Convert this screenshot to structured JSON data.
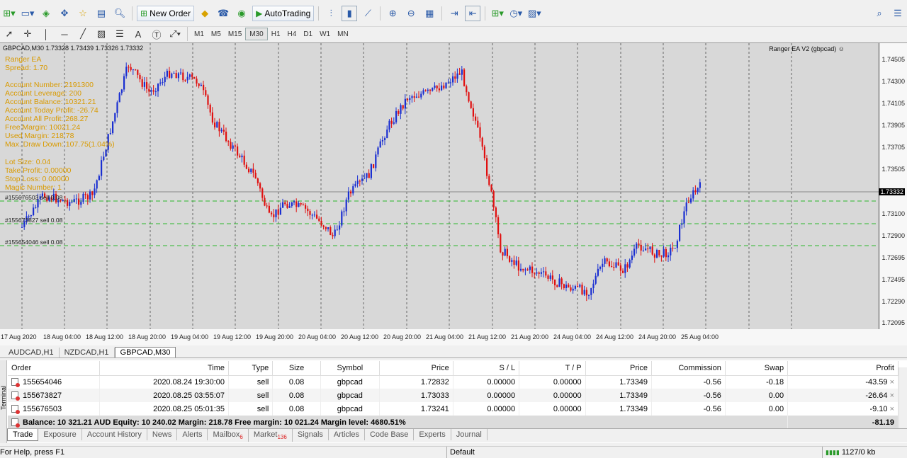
{
  "toolbar": {
    "new_order_label": "New Order",
    "autotrading_label": "AutoTrading",
    "timeframes": [
      "M1",
      "M5",
      "M15",
      "M30",
      "H1",
      "H4",
      "D1",
      "W1",
      "MN"
    ],
    "active_timeframe": "M30"
  },
  "chart": {
    "title": "GBPCAD,M30  1.73328 1.73439 1.73326 1.73332",
    "ea_label": "Ranger EA V2 (gbpcad) ☺",
    "current_price": "1.73332",
    "y_ticks": [
      "1.74505",
      "1.74300",
      "1.74105",
      "1.73905",
      "1.73705",
      "1.73505",
      "1.73100",
      "1.72900",
      "1.72695",
      "1.72495",
      "1.72290",
      "1.72095"
    ],
    "x_ticks": [
      "17 Aug 2020",
      "18 Aug 04:00",
      "18 Aug 12:00",
      "18 Aug 20:00",
      "19 Aug 04:00",
      "19 Aug 12:00",
      "19 Aug 20:00",
      "20 Aug 04:00",
      "20 Aug 12:00",
      "20 Aug 20:00",
      "21 Aug 04:00",
      "21 Aug 12:00",
      "21 Aug 20:00",
      "24 Aug 04:00",
      "24 Aug 12:00",
      "24 Aug 20:00",
      "25 Aug 04:00"
    ],
    "info_lines": [
      "Ranger EA",
      "Spread: 1.70",
      "Account Number: 2191300",
      "Account Leverage: 200",
      "Account Balance: 10321.21",
      "Account Today Profit: -26.74",
      "Account All Profit: 268.27",
      "Free Margin: 10021.24",
      "Used Margin: 218.78",
      "Max. Draw Down: 107.75(1.04%)",
      "Lot Size: 0.04",
      "Take Profit: 0.00000",
      "Stop Loss: 0.00000",
      "Magic Number: 1"
    ],
    "trade_labels": [
      "#155676503 sell 0.08",
      "#155673827 sell 0.08",
      "#155654046 sell 0.08"
    ]
  },
  "chart_tabs": [
    "AUDCAD,H1",
    "NZDCAD,H1",
    "GBPCAD,M30"
  ],
  "terminal": {
    "side_label": "Terminal",
    "headers": [
      "Order",
      "Time",
      "Type",
      "Size",
      "Symbol",
      "Price",
      "S / L",
      "T / P",
      "Price",
      "Commission",
      "Swap",
      "Profit"
    ],
    "rows": [
      [
        "155654046",
        "2020.08.24 19:30:00",
        "sell",
        "0.08",
        "gbpcad",
        "1.72832",
        "0.00000",
        "0.00000",
        "1.73349",
        "-0.56",
        "-0.18",
        "-43.59"
      ],
      [
        "155673827",
        "2020.08.25 03:55:07",
        "sell",
        "0.08",
        "gbpcad",
        "1.73033",
        "0.00000",
        "0.00000",
        "1.73349",
        "-0.56",
        "0.00",
        "-26.64"
      ],
      [
        "155676503",
        "2020.08.25 05:01:35",
        "sell",
        "0.08",
        "gbpcad",
        "1.73241",
        "0.00000",
        "0.00000",
        "1.73349",
        "-0.56",
        "0.00",
        "-9.10"
      ]
    ],
    "balance_line": "Balance: 10 321.21 AUD  Equity: 10 240.02  Margin: 218.78  Free margin: 10 021.24  Margin level: 4680.51%",
    "total_profit": "-81.19"
  },
  "bottom_tabs": [
    {
      "label": "Trade",
      "badge": ""
    },
    {
      "label": "Exposure",
      "badge": ""
    },
    {
      "label": "Account History",
      "badge": ""
    },
    {
      "label": "News",
      "badge": ""
    },
    {
      "label": "Alerts",
      "badge": ""
    },
    {
      "label": "Mailbox",
      "badge": "6"
    },
    {
      "label": "Market",
      "badge": "136"
    },
    {
      "label": "Signals",
      "badge": ""
    },
    {
      "label": "Articles",
      "badge": ""
    },
    {
      "label": "Code Base",
      "badge": ""
    },
    {
      "label": "Experts",
      "badge": ""
    },
    {
      "label": "Journal",
      "badge": ""
    }
  ],
  "status": {
    "help": "For Help, press F1",
    "profile": "Default",
    "traffic": "1127/0 kb"
  },
  "colors": {
    "bull": "#1a2fd1",
    "bear": "#e01010",
    "grid": "#7a7a7a",
    "info": "#d99a00",
    "order_line": "#2db82d"
  }
}
